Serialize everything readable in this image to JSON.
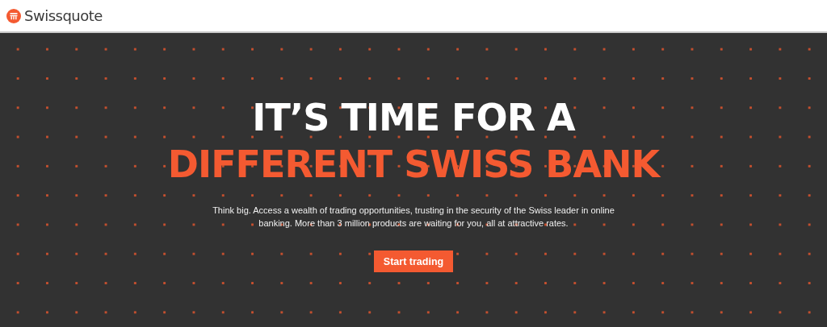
{
  "header": {
    "brand": "Swissquote"
  },
  "hero": {
    "headline": [
      "IT’S TIME FOR A",
      "DIFFERENT SWISS BANK"
    ],
    "description": "Think big. Access a wealth of trading opportunities, trusting in the security of the Swiss leader in online banking. More than 3 million products are waiting for you, all at attractive rates.",
    "cta": "Start trading"
  }
}
